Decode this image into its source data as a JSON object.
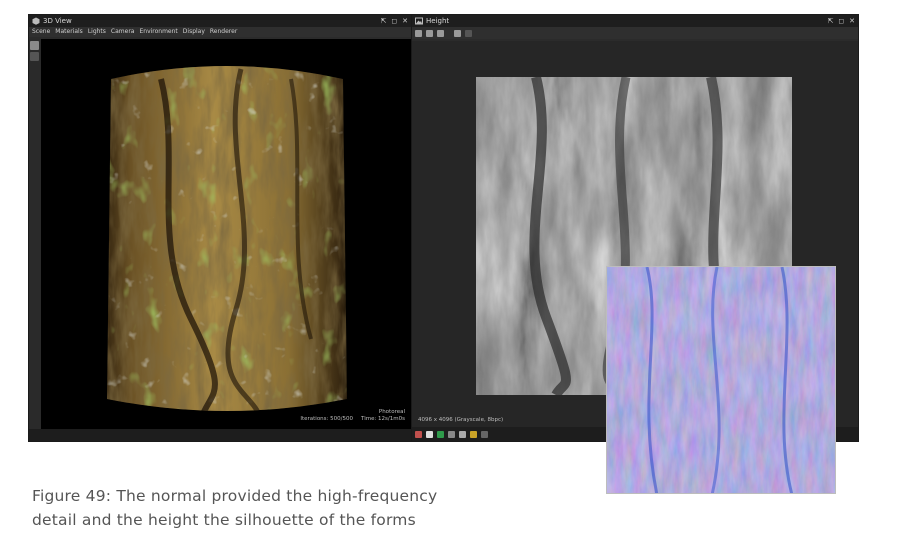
{
  "left_panel": {
    "title": "3D View",
    "menu": [
      "Scene",
      "Materials",
      "Lights",
      "Camera",
      "Environment",
      "Display",
      "Renderer"
    ],
    "render_mode": "Photoreal",
    "iterations": "Iterations: 500/500",
    "time": "Time: 12s/1m0s"
  },
  "right_panel": {
    "title": "Height",
    "image_info": "4096 x 4096 (Grayscale, 8bpc)"
  },
  "caption": {
    "line1": "Figure 49: The normal provided the high-frequency",
    "line2": "detail and the height the silhouette of the forms"
  },
  "colors": {
    "panel_bg": "#2b2b2b",
    "titlebar_bg": "#1e1e1e",
    "normal_map_base": "#7b78c4",
    "caption_text": "#555555"
  }
}
